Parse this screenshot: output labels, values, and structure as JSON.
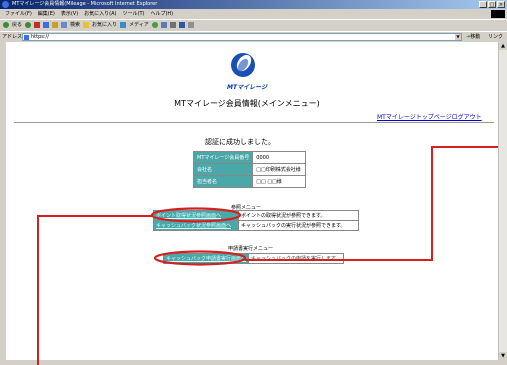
{
  "window": {
    "title": "MTマイレージ会員情報(Mileage - Microsoft Internet Explorer",
    "min": "_",
    "max": "□",
    "close": "×"
  },
  "menu": [
    "ファイル(F)",
    "編集(E)",
    "表示(V)",
    "お気に入り(A)",
    "ツール(T)",
    "ヘルプ(H)"
  ],
  "toolbar": {
    "back": "戻る",
    "search": "検索",
    "favorites": "お気に入り",
    "media": "メディア"
  },
  "address": {
    "label": "アドレス(D)",
    "url": "https://",
    "go": "移動",
    "links": "リンク"
  },
  "page": {
    "brand": "MTマイレージ",
    "title": "MTマイレージ会員情報(メインメニュー)",
    "top_link": "MTマイレージトップページ",
    "logout_link": "ログアウト",
    "auth_message": "認証に成功しました。",
    "member_info": [
      {
        "label": "MTマイレージ会員番号",
        "value": "0000"
      },
      {
        "label": "会社名",
        "value": "□□印刷株式会社様"
      },
      {
        "label": "担当者名",
        "value": "□□ □□様"
      }
    ],
    "ref_section": "参照メニュー",
    "ref_items": [
      {
        "button": "ポイント取得状況参照画面へ",
        "desc": "ポイントの取得状況が参照できます。"
      },
      {
        "button": "キャッシュバック状況参照画面へ",
        "desc": "キャッシュバックの実行状況が参照できます。"
      }
    ],
    "exec_section": "申請書実行メニュー",
    "exec_items": [
      {
        "button": "キャッシュバック申請書実行画面へ",
        "desc": "キャッシュバックの申請を実行します。"
      }
    ]
  },
  "colors": {
    "teal": "#4aa8a8",
    "annotation_red": "#d42020",
    "link_blue": "#0000cc"
  }
}
